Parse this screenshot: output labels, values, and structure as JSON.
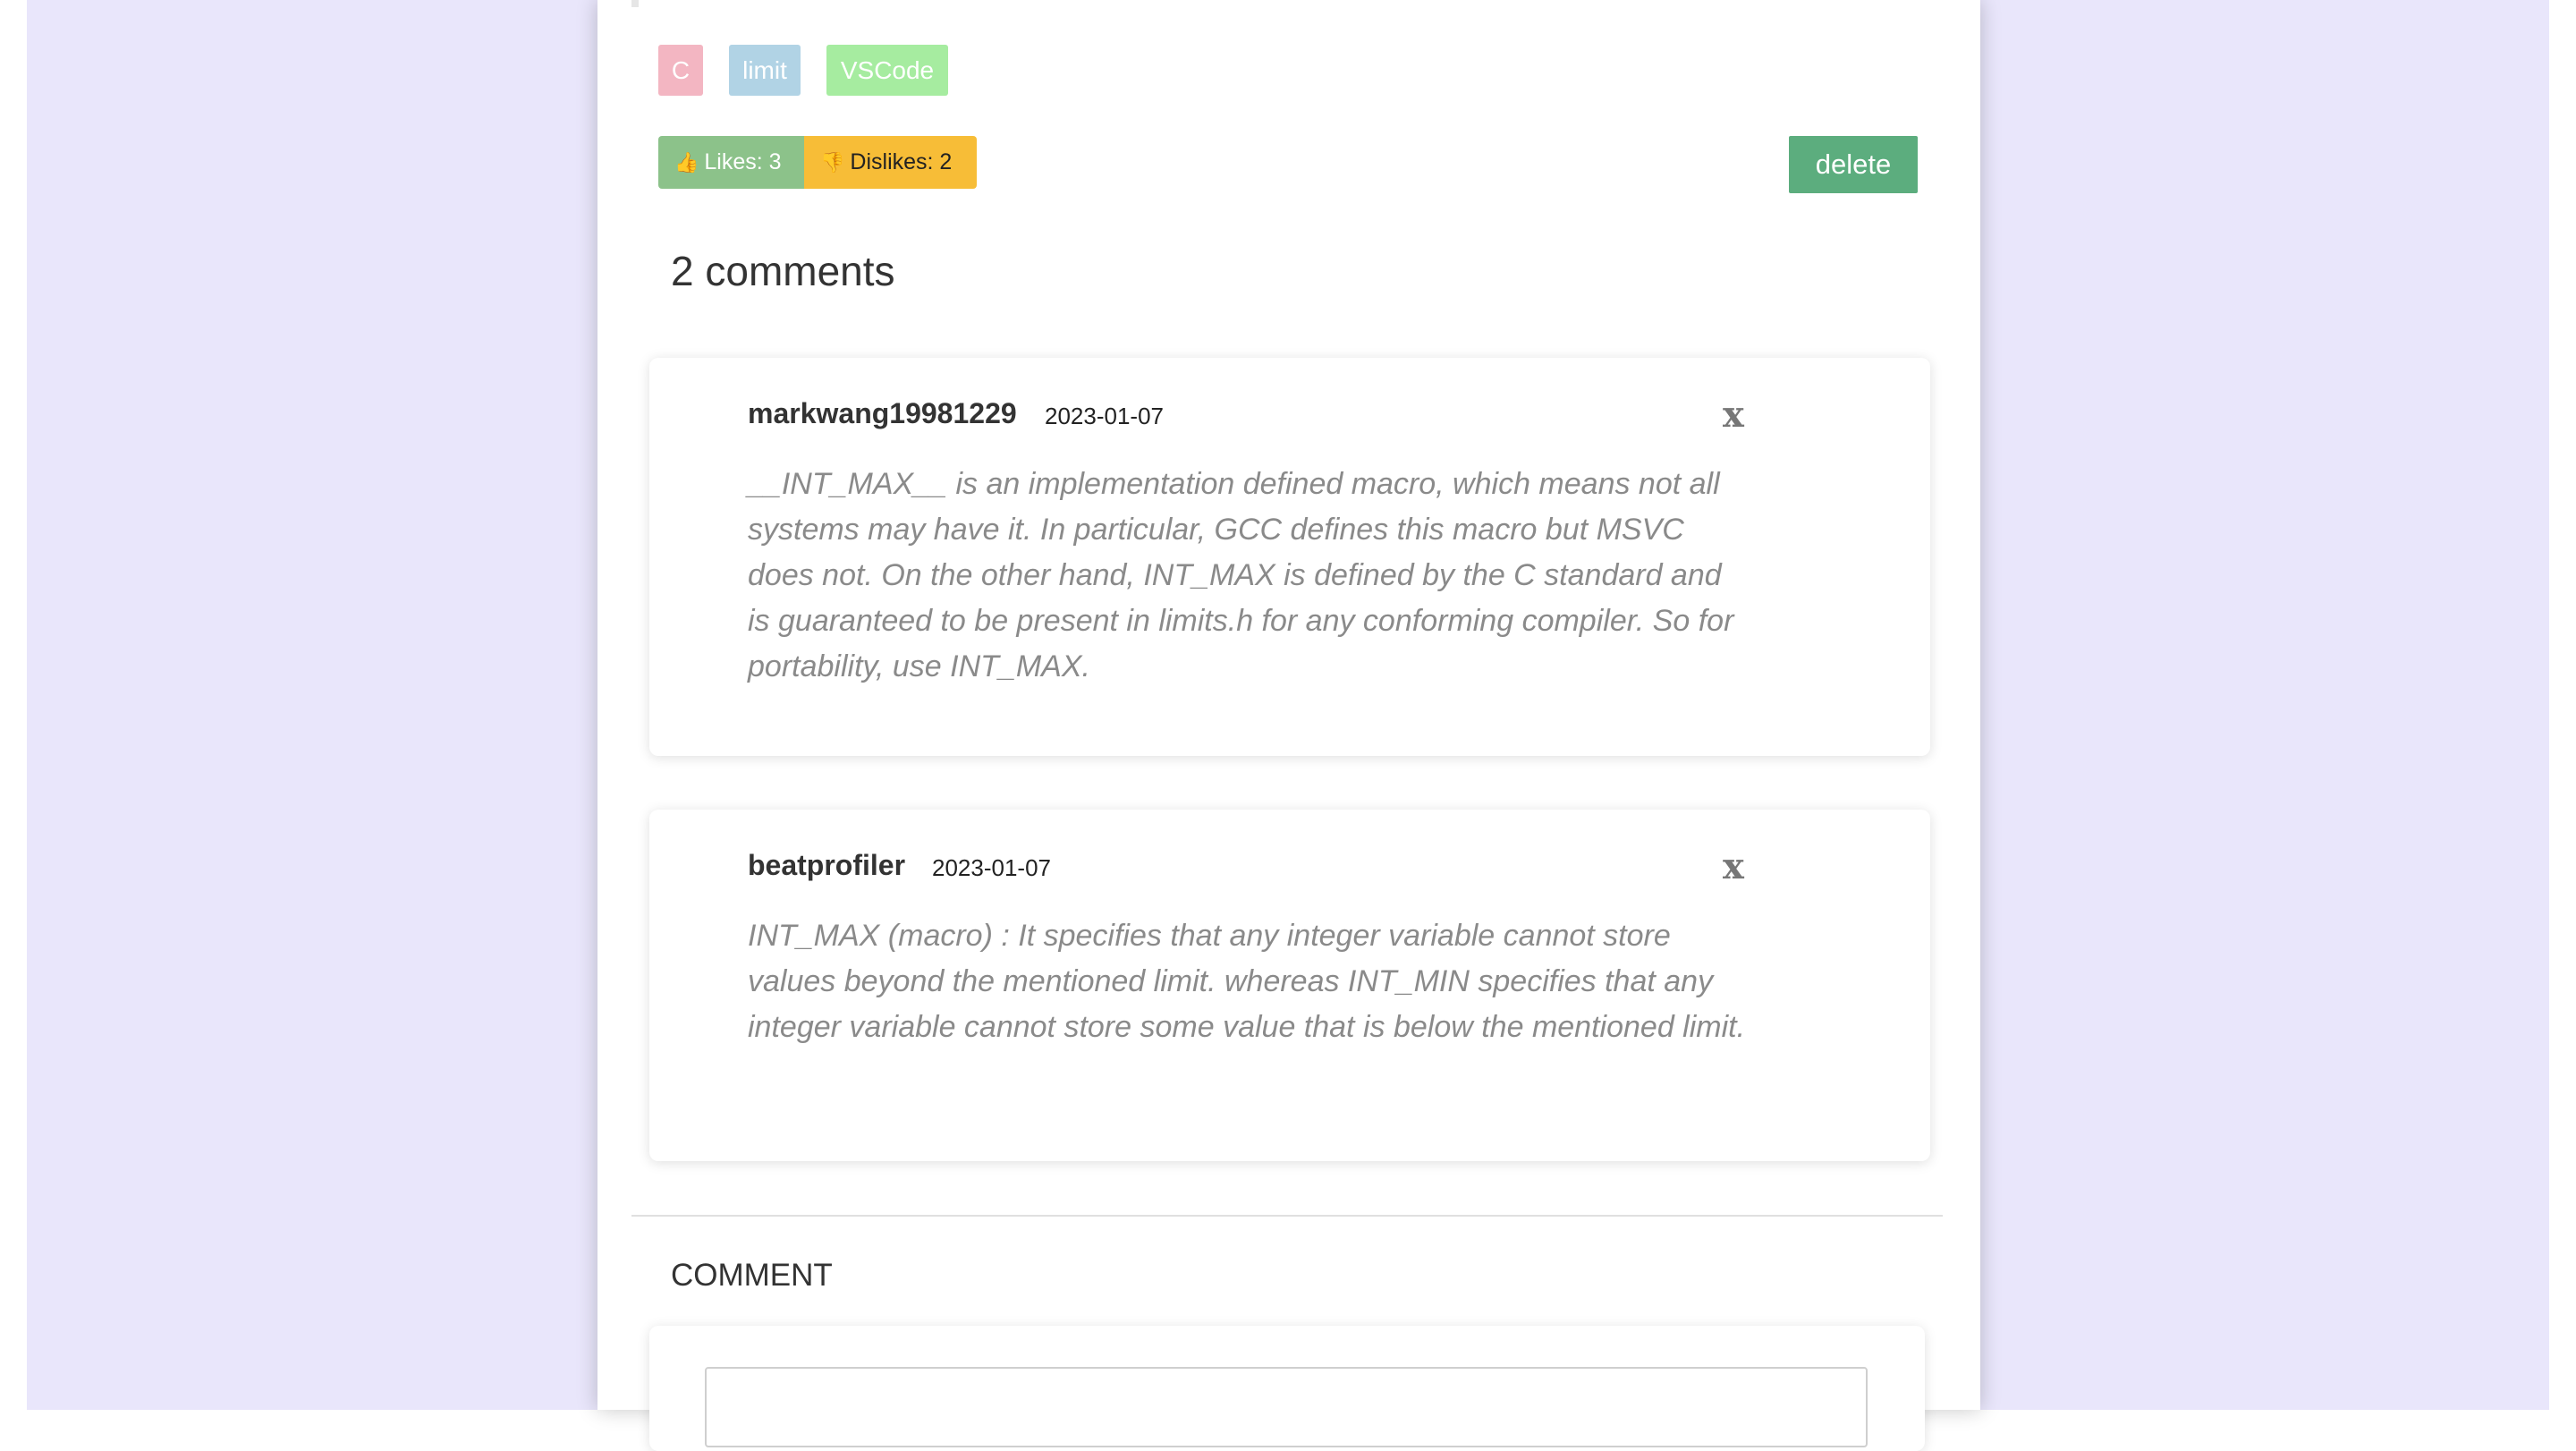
{
  "tags": [
    "C",
    "limit",
    "VSCode"
  ],
  "votes": {
    "likes_label": "Likes: 3",
    "dislikes_label": "Dislikes: 2",
    "like_icon": "thumbs-up-icon",
    "dislike_icon": "thumbs-down-icon"
  },
  "actions": {
    "delete_label": "delete"
  },
  "comments_count_label": "2 comments",
  "comments": [
    {
      "author": "markwang19981229",
      "date": "2023-01-07",
      "close_label": "x",
      "text": "__INT_MAX__ is an implementation defined macro, which means not all systems may have it. In particular, GCC defines this macro but MSVC does not. On the other hand, INT_MAX is defined by the C standard and is guaranteed to be present in limits.h for any conforming compiler. So for portability, use INT_MAX."
    },
    {
      "author": "beatprofiler",
      "date": "2023-01-07",
      "close_label": "x",
      "text": "INT_MAX (macro) : It specifies that any integer variable cannot store values beyond the mentioned limit. whereas INT_MIN specifies that any integer variable cannot store some value that is below the mentioned limit."
    }
  ],
  "comment_form": {
    "heading": "COMMENT",
    "input_value": ""
  },
  "colors": {
    "page_background": "#e9e6fb",
    "tag_c": "#f3b6c2",
    "tag_limit": "#b1d3e5",
    "tag_vscode": "#a6eca0",
    "likes": "#8cc28a",
    "dislikes": "#f7bd37",
    "delete": "#5cad7e"
  }
}
